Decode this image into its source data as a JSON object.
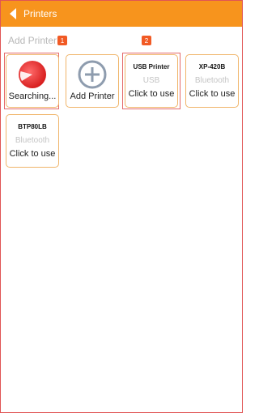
{
  "header": {
    "title": "Printers",
    "background_color": "#f7941d"
  },
  "section": {
    "label": "Add Printer"
  },
  "badges": [
    "1",
    "2"
  ],
  "cards": {
    "searching": {
      "label": "Searching...",
      "icon": "searching-spinner-icon"
    },
    "add_printer": {
      "label": "Add Printer",
      "icon": "plus-circle-icon"
    }
  },
  "printers": [
    {
      "name": "USB Printer",
      "type": "USB",
      "action": "Click to use"
    },
    {
      "name": "XP-420B",
      "type": "Bluetooth",
      "action": "Click to use"
    },
    {
      "name": "BTP80LB",
      "type": "Bluetooth",
      "action": "Click to use"
    }
  ],
  "colors": {
    "accent": "#f7941d",
    "badge": "#f15a24",
    "card_border": "#f0b56a",
    "highlight_border": "#e46a6a"
  }
}
